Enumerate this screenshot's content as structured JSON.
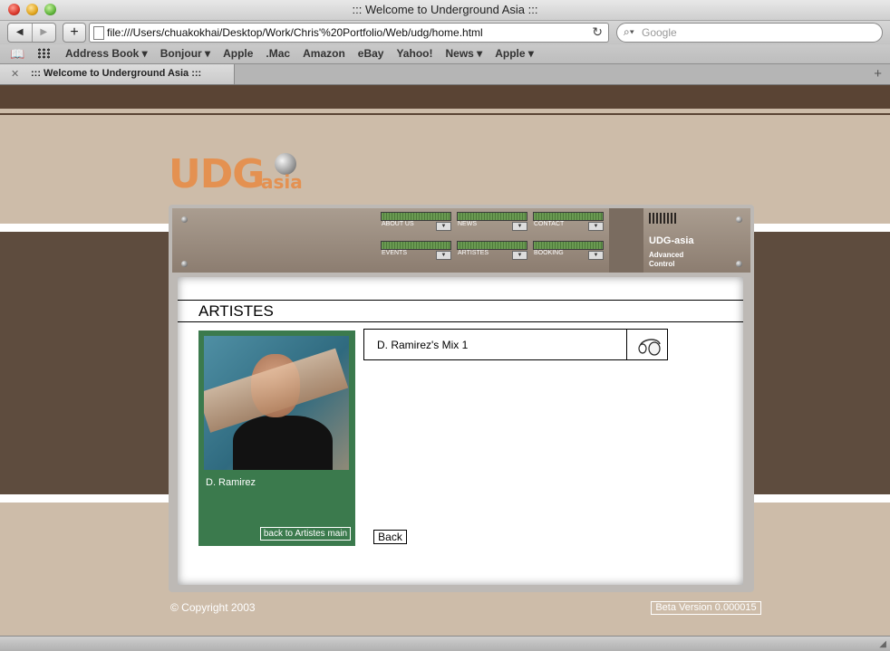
{
  "window": {
    "title": "::: Welcome to Underground Asia :::"
  },
  "toolbar": {
    "back_icon": "back-arrow-icon",
    "forward_icon": "forward-arrow-icon",
    "add_label": "+",
    "url": "file:///Users/chuakokhai/Desktop/Work/Chris'%20Portfolio/Web/udg/home.html",
    "reload_icon": "reload-icon",
    "search_placeholder": "Google"
  },
  "bookmarks": {
    "items": [
      {
        "label": "Address Book ▾"
      },
      {
        "label": "Bonjour ▾"
      },
      {
        "label": "Apple"
      },
      {
        "label": ".Mac"
      },
      {
        "label": "Amazon"
      },
      {
        "label": "eBay"
      },
      {
        "label": "Yahoo!"
      },
      {
        "label": "News ▾"
      },
      {
        "label": "Apple ▾"
      }
    ]
  },
  "tabs": {
    "active_title": "::: Welcome to Underground Asia :::"
  },
  "site": {
    "logo_main": "UDG",
    "logo_sub": "asia",
    "nav": [
      {
        "label": "ABOUT US"
      },
      {
        "label": "NEWS"
      },
      {
        "label": "CONTACT"
      },
      {
        "label": "EVENTS"
      },
      {
        "label": "ARTISTES"
      },
      {
        "label": "BOOKING"
      }
    ],
    "brand_title": "UDG-asia",
    "brand_sub": "Advanced\nControl",
    "page_title": "ARTISTES",
    "artist_name": "D. Ramirez",
    "back_to_artists": "back to Artistes main",
    "mix_title": "D. Ramirez's Mix 1",
    "back_label": "Back",
    "copyright": "© Copyright 2003",
    "beta": "Beta Version 0.000015"
  }
}
